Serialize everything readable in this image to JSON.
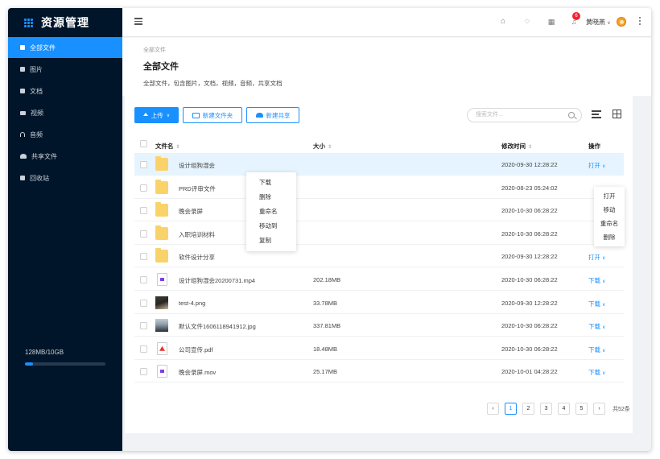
{
  "app": {
    "title": "资源管理"
  },
  "sidebar": {
    "items": [
      {
        "label": "全部文件",
        "icon": "grid-icon",
        "active": true
      },
      {
        "label": "图片",
        "icon": "image-icon"
      },
      {
        "label": "文档",
        "icon": "document-icon"
      },
      {
        "label": "视频",
        "icon": "video-icon"
      },
      {
        "label": "音频",
        "icon": "headphones-icon"
      },
      {
        "label": "共享文件",
        "icon": "people-icon"
      },
      {
        "label": "回收站",
        "icon": "trash-icon"
      }
    ],
    "storage": {
      "text": "128MB/10GB",
      "used_fraction": 0.1
    }
  },
  "header": {
    "notification_count": "6",
    "user_name": "黄晓燕"
  },
  "page": {
    "breadcrumb": "全部文件",
    "title": "全部文件",
    "description": "全部文件，包含图片，文档，视频，音频，共享文档"
  },
  "toolbar": {
    "upload_label": "上传",
    "new_folder_label": "新建文件夹",
    "new_share_label": "新建共享",
    "search_placeholder": "搜索文件..."
  },
  "table": {
    "headers": {
      "name": "文件名",
      "size": "大小",
      "modified": "修改时间",
      "actions": "操作"
    },
    "rows": [
      {
        "type": "folder",
        "name": "设计组狗湿会",
        "size": "",
        "date": "2020-09-30 12:28:22",
        "action": "打开",
        "highlight": true
      },
      {
        "type": "folder",
        "name": "PRD评审文件",
        "size": "",
        "date": "2020-08-23 05:24:02",
        "action": ""
      },
      {
        "type": "folder",
        "name": "晚会录屏",
        "size": "",
        "date": "2020-10-30 06:28:22",
        "action": ""
      },
      {
        "type": "folder",
        "name": "入职培训材料",
        "size": "",
        "date": "2020-10-30 06:28:22",
        "action": ""
      },
      {
        "type": "folder",
        "name": "软件设计分享",
        "size": "",
        "date": "2020-09-30 12:28:22",
        "action": "打开"
      },
      {
        "type": "video",
        "name": "设计组狗湿会20200731.mp4",
        "size": "202.18MB",
        "date": "2020-10-30 06:28:22",
        "action": "下载"
      },
      {
        "type": "image1",
        "name": "test-4.png",
        "size": "33.78MB",
        "date": "2020-09-30 12:28:22",
        "action": "下载"
      },
      {
        "type": "image2",
        "name": "默认文件1606118941912.jpg",
        "size": "337.81MB",
        "date": "2020-10-30 06:28:22",
        "action": "下载"
      },
      {
        "type": "pdf",
        "name": "公司宣传.pdf",
        "size": "18.48MB",
        "date": "2020-10-30 06:28:22",
        "action": "下载"
      },
      {
        "type": "video",
        "name": "晚会录屏.mov",
        "size": "25.17MB",
        "date": "2020-10-01 04:28:22",
        "action": "下载"
      }
    ]
  },
  "context_menu": {
    "items": [
      "下载",
      "删除",
      "重命名",
      "移动到",
      "复制"
    ]
  },
  "action_menu": {
    "items": [
      "打开",
      "移动",
      "重命名",
      "删除"
    ]
  },
  "pagination": {
    "pages": [
      "1",
      "2",
      "3",
      "4",
      "5"
    ],
    "current": "1",
    "total": "共52条"
  },
  "colors": {
    "primary": "#1890ff",
    "sidebar_bg": "#001529",
    "badge": "#f5222d",
    "folder": "#f9d36a"
  }
}
